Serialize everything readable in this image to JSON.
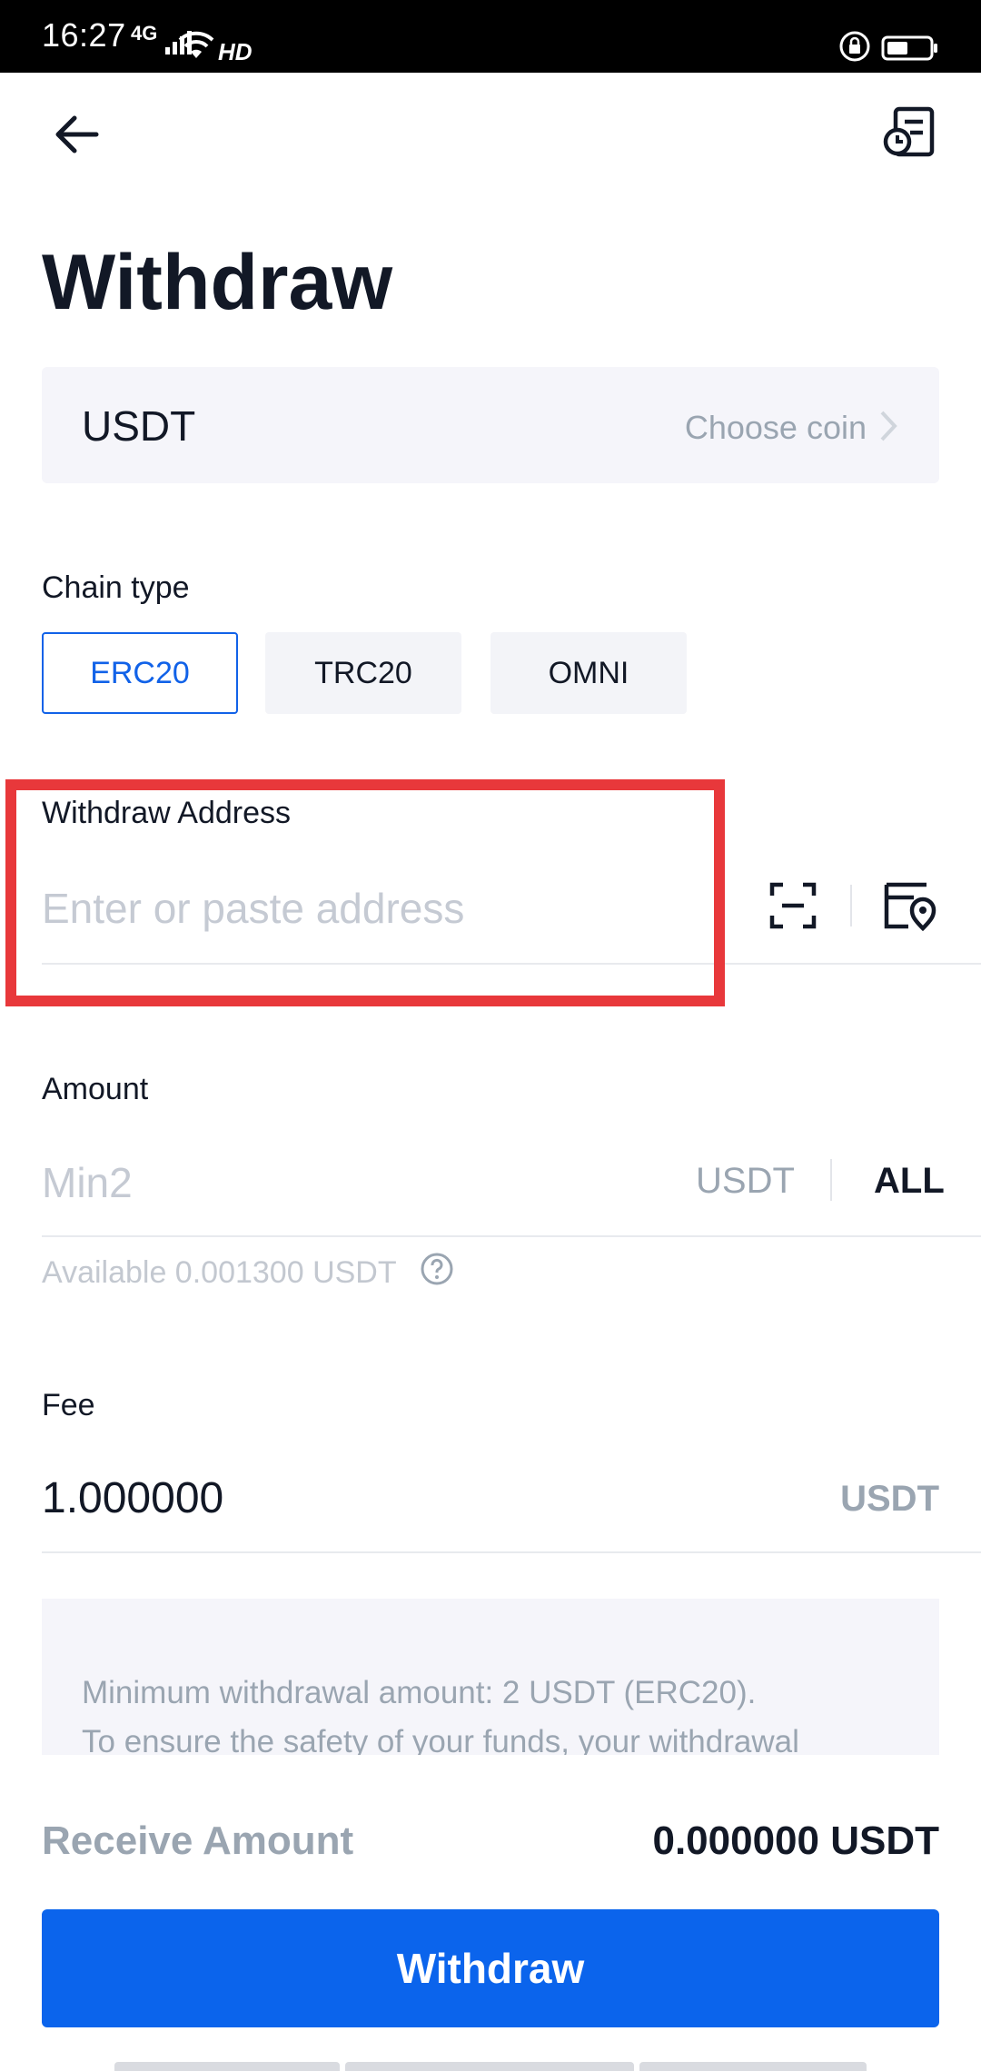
{
  "status_bar": {
    "time": "16:27",
    "network": "4G",
    "hd": "HD"
  },
  "header": {
    "back_icon": "arrow-left",
    "history_icon": "record-history"
  },
  "page": {
    "title": "Withdraw"
  },
  "coin": {
    "selected": "USDT",
    "choose_label": "Choose coin"
  },
  "chain": {
    "label": "Chain type",
    "options": [
      "ERC20",
      "TRC20",
      "OMNI"
    ],
    "selected": "ERC20"
  },
  "address": {
    "label": "Withdraw Address",
    "placeholder": "Enter or paste address",
    "value": ""
  },
  "amount": {
    "label": "Amount",
    "placeholder": "Min2",
    "value": "",
    "unit": "USDT",
    "all_label": "ALL",
    "available": "Available 0.001300 USDT"
  },
  "fee": {
    "label": "Fee",
    "value": "1.000000",
    "unit": "USDT"
  },
  "notice": {
    "lines": [
      "Minimum withdrawal amount: 2 USDT (ERC20).",
      "To ensure the safety of your funds, your withdrawal"
    ]
  },
  "receive": {
    "label": "Receive Amount",
    "value": "0.000000 USDT"
  },
  "actions": {
    "withdraw_label": "Withdraw"
  },
  "colors": {
    "accent": "#0b64ec",
    "highlight": "#e8383b",
    "muted_text": "#9aa5b1",
    "field_bg": "#f5f5fa"
  }
}
